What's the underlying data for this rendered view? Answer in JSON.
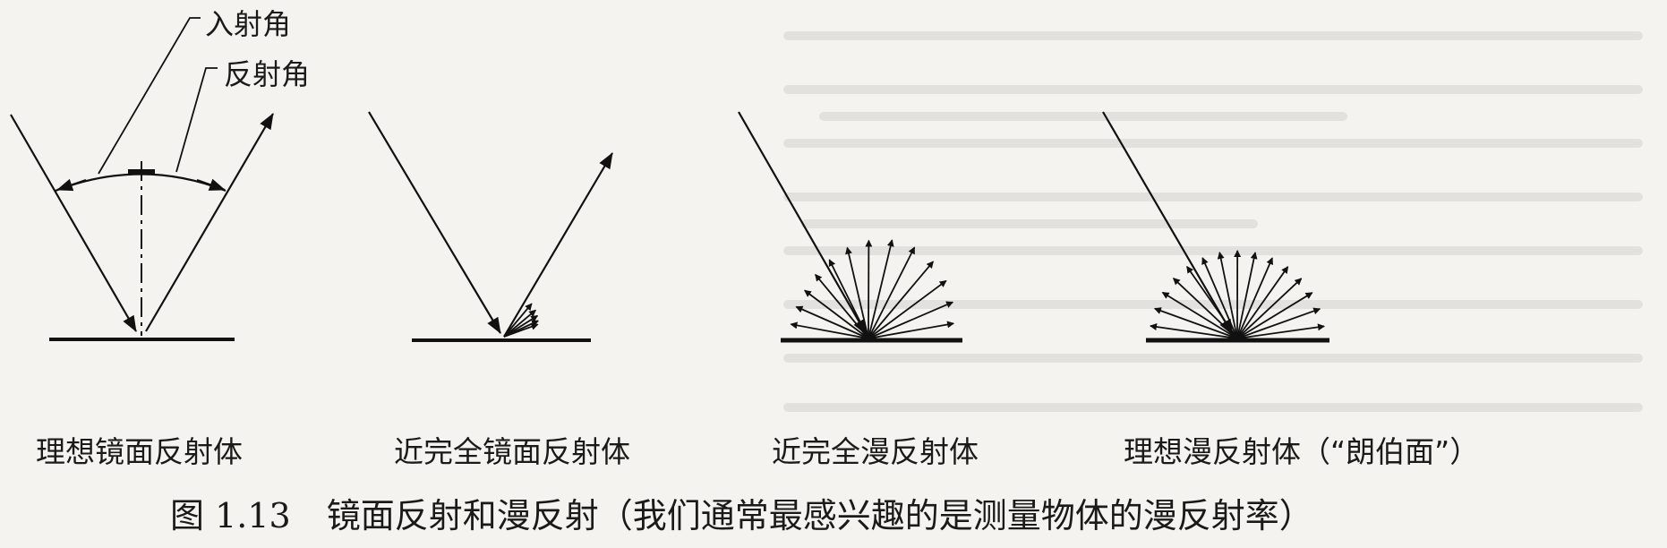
{
  "annotations": {
    "incidence_angle": "入射角",
    "reflection_angle": "反射角"
  },
  "panels": [
    {
      "label": "理想镜面反射体"
    },
    {
      "label": "近完全镜面反射体"
    },
    {
      "label": "近完全漫反射体"
    },
    {
      "label": "理想漫反射体（“朗伯面”）"
    }
  ],
  "caption": {
    "number": "图 1.13",
    "text": "镜面反射和漫反射（我们通常最感兴趣的是测量物体的漫反射率）"
  }
}
